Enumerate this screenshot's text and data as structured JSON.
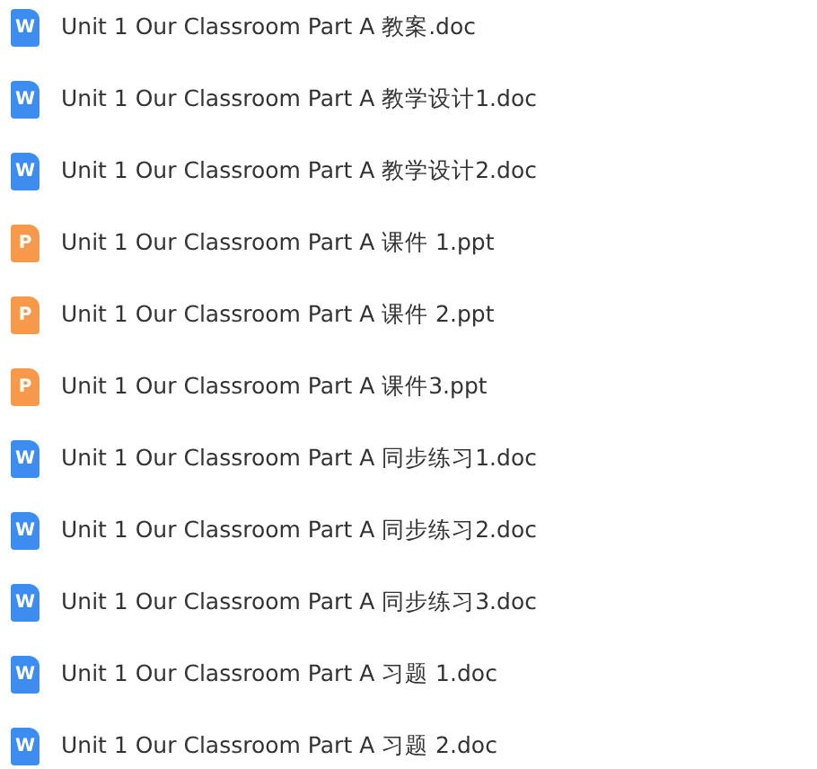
{
  "files": [
    {
      "name": "Unit 1 Our Classroom Part A 教案.doc",
      "kind": "doc",
      "icon_letter": "W"
    },
    {
      "name": "Unit 1 Our Classroom Part A 教学设计1.doc",
      "kind": "doc",
      "icon_letter": "W"
    },
    {
      "name": "Unit 1 Our Classroom Part A 教学设计2.doc",
      "kind": "doc",
      "icon_letter": "W"
    },
    {
      "name": "Unit 1 Our Classroom Part A 课件 1.ppt",
      "kind": "ppt",
      "icon_letter": "P"
    },
    {
      "name": "Unit 1 Our Classroom Part A 课件 2.ppt",
      "kind": "ppt",
      "icon_letter": "P"
    },
    {
      "name": "Unit 1 Our Classroom Part A 课件3.ppt",
      "kind": "ppt",
      "icon_letter": "P"
    },
    {
      "name": "Unit 1 Our Classroom Part A 同步练习1.doc",
      "kind": "doc",
      "icon_letter": "W"
    },
    {
      "name": "Unit 1 Our Classroom Part A 同步练习2.doc",
      "kind": "doc",
      "icon_letter": "W"
    },
    {
      "name": "Unit 1 Our Classroom Part A 同步练习3.doc",
      "kind": "doc",
      "icon_letter": "W"
    },
    {
      "name": "Unit 1 Our Classroom Part A 习题 1.doc",
      "kind": "doc",
      "icon_letter": "W"
    },
    {
      "name": "Unit 1 Our Classroom Part A 习题 2.doc",
      "kind": "doc",
      "icon_letter": "W"
    }
  ]
}
